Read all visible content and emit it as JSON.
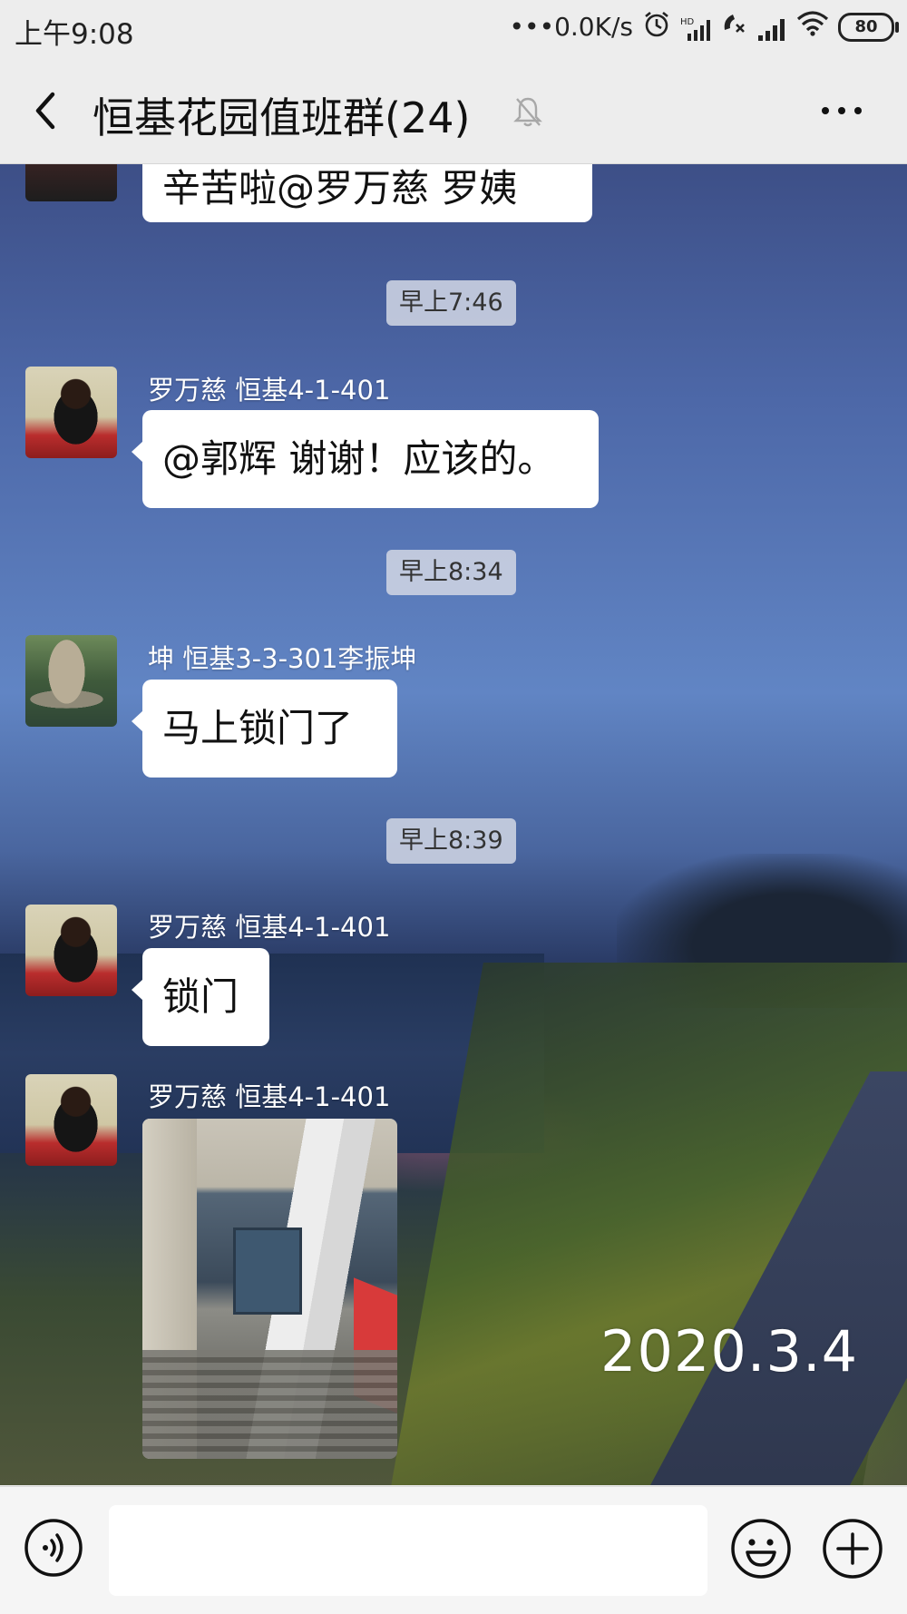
{
  "status_bar": {
    "time": "上午9:08",
    "network_speed": "•••0.0K/s",
    "battery": "80",
    "icons": [
      "alarm-icon",
      "hd-signal-icon",
      "no-call-icon",
      "cell-signal-icon",
      "wifi-icon",
      "battery-icon"
    ]
  },
  "header": {
    "title": "恒基花园值班群(24)",
    "icons": [
      "back-icon",
      "mute-bell-icon",
      "more-icon"
    ]
  },
  "messages": [
    {
      "type": "text",
      "sender": "",
      "text": "辛苦啦@罗万慈  罗姨",
      "avatar": "person-avatar"
    },
    {
      "type": "time",
      "text": "早上7:46"
    },
    {
      "type": "text",
      "sender": "罗万慈 恒基4-1-401",
      "text": "@郭辉  谢谢！应该的。",
      "avatar": "person-avatar"
    },
    {
      "type": "time",
      "text": "早上8:34"
    },
    {
      "type": "text",
      "sender": "坤 恒基3-3-301李振坤",
      "text": "马上锁门了",
      "avatar": "fountain-avatar"
    },
    {
      "type": "time",
      "text": "早上8:39"
    },
    {
      "type": "text",
      "sender": "罗万慈 恒基4-1-401",
      "text": "锁门",
      "avatar": "person-avatar"
    },
    {
      "type": "image",
      "sender": "罗万慈 恒基4-1-401",
      "image": "stairwell-photo",
      "avatar": "person-avatar"
    }
  ],
  "background": {
    "date_stamp": "2020.3.4"
  },
  "input_bar": {
    "value": "",
    "icons": [
      "voice-icon",
      "emoji-icon",
      "plus-icon"
    ]
  }
}
